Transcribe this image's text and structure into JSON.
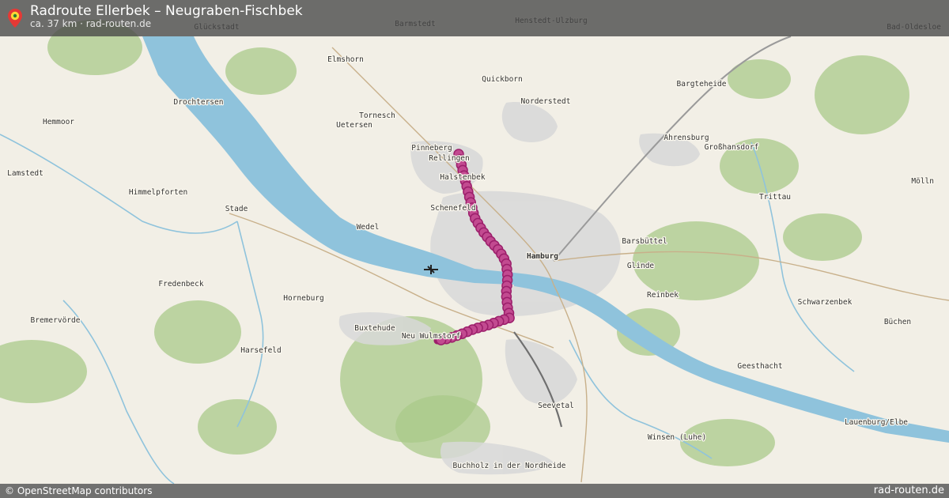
{
  "header": {
    "title": "Radroute Ellerbek – Neugraben-Fischbek",
    "subtitle": "ca. 37 km · rad-routen.de"
  },
  "footer": {
    "attribution": "© OpenStreetMap contributors",
    "brand": "rad-routen.de"
  },
  "colors": {
    "route": "#9c1f6b",
    "route_marker": "#c24a90",
    "water": "#8fc3dc",
    "land": "#f2efe6",
    "forest": "#a9c98a",
    "urban": "#d8d8d8"
  },
  "icons": {
    "route_pin": "map-pin-icon",
    "airport": "airplane-icon"
  },
  "map": {
    "places": [
      {
        "name": "Glückstadt"
      },
      {
        "name": "Barmstedt"
      },
      {
        "name": "Henstedt-Ulzburg"
      },
      {
        "name": "Bad-Oldesloe"
      },
      {
        "name": "Elmshorn"
      },
      {
        "name": "Quickborn"
      },
      {
        "name": "Bargteheide"
      },
      {
        "name": "Drochtersen"
      },
      {
        "name": "Norderstedt"
      },
      {
        "name": "Tornesch"
      },
      {
        "name": "Uetersen"
      },
      {
        "name": "Hemmoor"
      },
      {
        "name": "Ahrensburg"
      },
      {
        "name": "Großhansdorf"
      },
      {
        "name": "Pinneberg"
      },
      {
        "name": "Rellingen"
      },
      {
        "name": "Lamstedt"
      },
      {
        "name": "Halstenbek"
      },
      {
        "name": "Himmelpforten"
      },
      {
        "name": "Trittau"
      },
      {
        "name": "Mölln"
      },
      {
        "name": "Stade"
      },
      {
        "name": "Schenefeld"
      },
      {
        "name": "Wedel"
      },
      {
        "name": "Barsbüttel"
      },
      {
        "name": "Hamburg"
      },
      {
        "name": "Glinde"
      },
      {
        "name": "Fredenbeck"
      },
      {
        "name": "Reinbek"
      },
      {
        "name": "Horneburg"
      },
      {
        "name": "Schwarzenbek"
      },
      {
        "name": "Bremervörde"
      },
      {
        "name": "Buxtehude"
      },
      {
        "name": "Büchen"
      },
      {
        "name": "Neu Wulmstorf"
      },
      {
        "name": "Harsefeld"
      },
      {
        "name": "Geesthacht"
      },
      {
        "name": "Seevetal"
      },
      {
        "name": "Winsen (Luhe)"
      },
      {
        "name": "Lauenburg/Elbe"
      },
      {
        "name": "Buchholz in der Nordheide"
      }
    ]
  }
}
